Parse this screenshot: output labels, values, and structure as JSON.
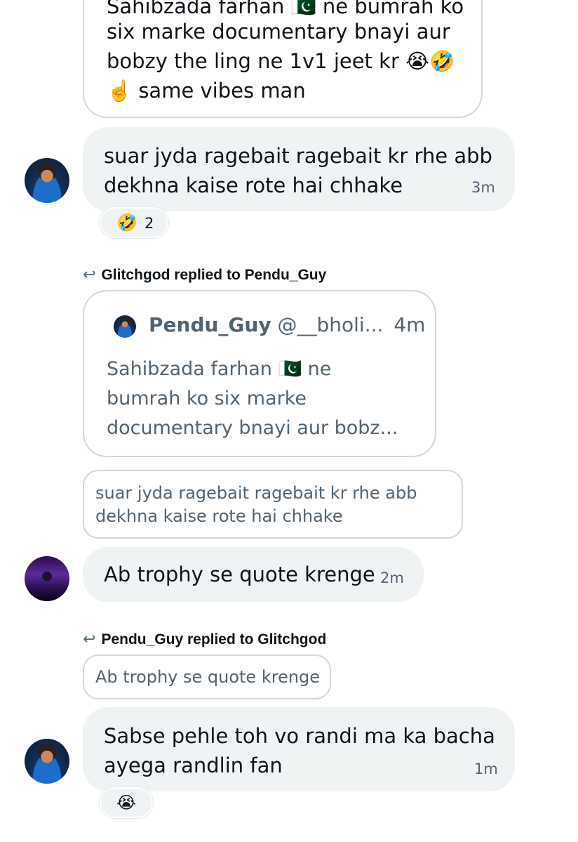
{
  "top_quote": {
    "cut_text": "Sahibzada farhan 🇵🇰 ne bumrah ko",
    "body_lines": [
      "six marke documentary bnayi aur",
      "bobzy the ling ne 1v1 jeet kr 😭🤣",
      "☝️ same vibes man"
    ]
  },
  "msg1": {
    "lines": [
      "suar jyda ragebait ragebait kr rhe abb",
      "dekhna kaise rote hai chhake"
    ],
    "time": "3m",
    "reaction_emoji": "🤣",
    "reaction_count": "2",
    "avatar": "user-avatar"
  },
  "reply1": {
    "arrow": "↩",
    "label": "Glitchgod replied to Pendu_Guy"
  },
  "quoted_post": {
    "name": "Pendu_Guy",
    "handle": "@__bholi...",
    "time": "4m",
    "lines": [
      "Sahibzada farhan 🇵🇰 ne",
      "bumrah ko six marke",
      "documentary bnayi aur bobz..."
    ]
  },
  "quoted_reply1": {
    "lines": [
      "suar jyda ragebait ragebait kr rhe abb",
      "dekhna kaise rote hai chhake"
    ]
  },
  "msg2": {
    "text": "Ab trophy se quote krenge",
    "time": "2m",
    "avatar": "user-avatar"
  },
  "reply2": {
    "arrow": "↩",
    "label": "Pendu_Guy replied to Glitchgod"
  },
  "quoted_reply2": {
    "text": "Ab trophy se quote krenge"
  },
  "msg3": {
    "lines": [
      "Sabse pehle toh vo randi ma ka bacha",
      "ayega randlin fan"
    ],
    "time": "1m",
    "reaction_emoji": "😭"
  },
  "colors": {
    "bubble_bg": "#eff3f4",
    "border": "#cfd9de",
    "muted_text": "#536471",
    "text": "#0f1419"
  }
}
